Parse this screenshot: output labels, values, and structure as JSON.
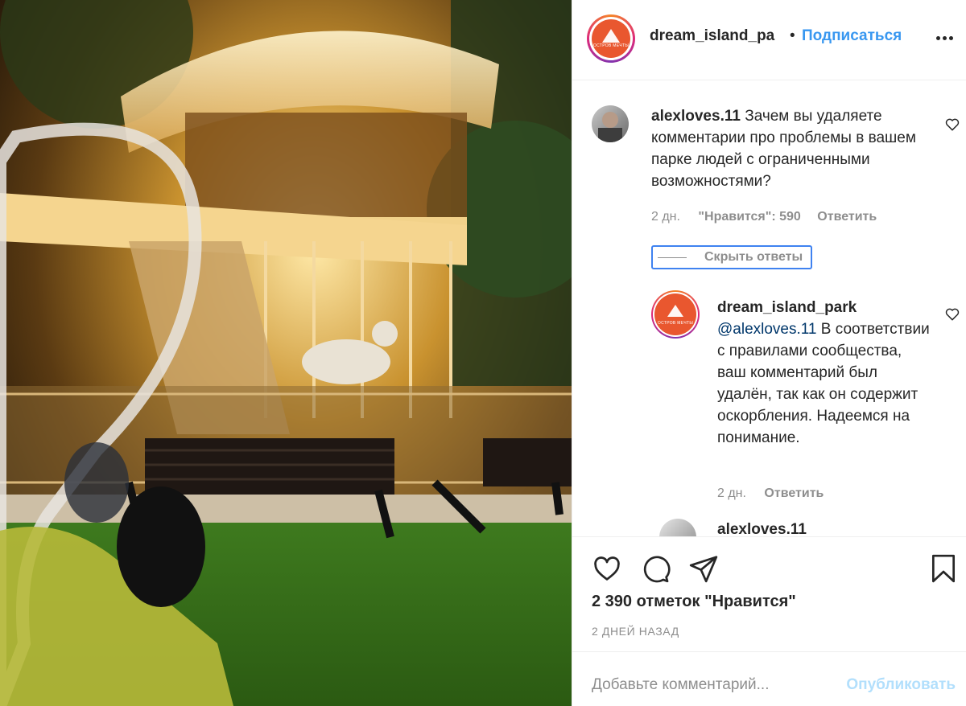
{
  "post": {
    "username": "dream_island_pa",
    "dot": "•",
    "follow_label": "Подписаться",
    "logo_text": "ОСТРОВ МЕЧТЫ"
  },
  "comments": [
    {
      "username": "alexloves.11",
      "text": "Зачем вы удаляете комментарии про проблемы в вашем парке людей с ограниченными возможностями?",
      "time": "2 дн.",
      "likes": "\"Нравится\": 590",
      "reply_label": "Ответить",
      "hide_replies_label": "Скрыть ответы"
    }
  ],
  "reply": {
    "username": "dream_island_park",
    "mention": "@alexloves.11",
    "text": "В соответствии с правилами сообщества, ваш комментарий был удалён, так как он содержит оскорбления. Надеемся на понимание.",
    "time": "2 дн.",
    "reply_label": "Ответить"
  },
  "next_comment": {
    "username": "alexloves.11"
  },
  "actions": {
    "likes_count": "2 390 отметок \"Нравится\"",
    "date": "2 ДНЕЙ НАЗАД"
  },
  "composer": {
    "placeholder": "Добавьте комментарий...",
    "post_label": "Опубликовать"
  },
  "icons": {
    "like": "heart-icon",
    "comment": "comment-bubble-icon",
    "share": "paper-plane-icon",
    "save": "bookmark-icon",
    "more": "more-dots-icon"
  },
  "colors": {
    "accent": "#3897f0",
    "brand": "#e9572f",
    "muted": "#8e8e8e",
    "focus": "#3f82f0",
    "post_disabled": "#b2dffc"
  }
}
